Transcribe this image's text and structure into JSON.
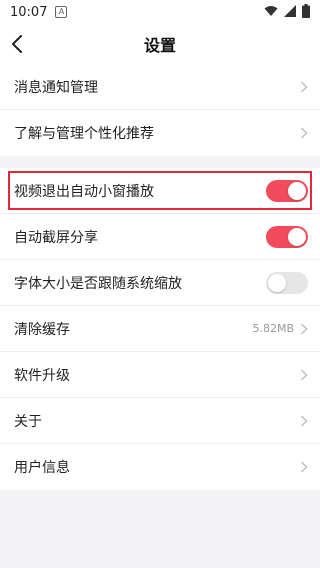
{
  "status": {
    "time": "10:07",
    "notification_icon": "A"
  },
  "header": {
    "title": "设置"
  },
  "group1": {
    "items": [
      {
        "label": "消息通知管理"
      },
      {
        "label": "了解与管理个性化推荐"
      }
    ]
  },
  "group2": {
    "items": [
      {
        "label": "视频退出自动小窗播放",
        "toggle": "on"
      },
      {
        "label": "自动截屏分享",
        "toggle": "on"
      },
      {
        "label": "字体大小是否跟随系统缩放",
        "toggle": "off"
      },
      {
        "label": "清除缓存",
        "value": "5.82MB"
      },
      {
        "label": "软件升级"
      },
      {
        "label": "关于"
      },
      {
        "label": "用户信息"
      }
    ]
  },
  "colors": {
    "accent": "#f24b5b",
    "highlight": "#e02c3a",
    "background": "#f4f4f6"
  }
}
